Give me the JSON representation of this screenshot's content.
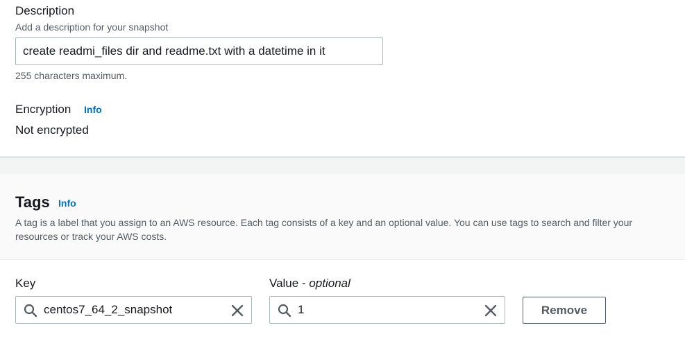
{
  "description": {
    "label": "Description",
    "hint": "Add a description for your snapshot",
    "value": "create readmi_files dir and readme.txt with a datetime in it",
    "constraint": "255 characters maximum."
  },
  "encryption": {
    "label": "Encryption",
    "info_label": "Info",
    "value": "Not encrypted"
  },
  "tags": {
    "title": "Tags",
    "info_label": "Info",
    "description": "A tag is a label that you assign to an AWS resource. Each tag consists of a key and an optional value. You can use tags to search and filter your resources or track your AWS costs.",
    "key_label": "Key",
    "value_label": "Value",
    "value_optional": "optional",
    "value_separator": " - ",
    "rows": [
      {
        "key": "centos7_64_2_snapshot",
        "value": "1",
        "remove_label": "Remove"
      }
    ]
  },
  "icons": {
    "search": "search-icon",
    "clear": "close-icon"
  },
  "colors": {
    "link": "#0073bb",
    "text": "#16191f",
    "muted": "#545b64",
    "border": "#aab7b8",
    "section_gray": "#f2f3f3"
  }
}
